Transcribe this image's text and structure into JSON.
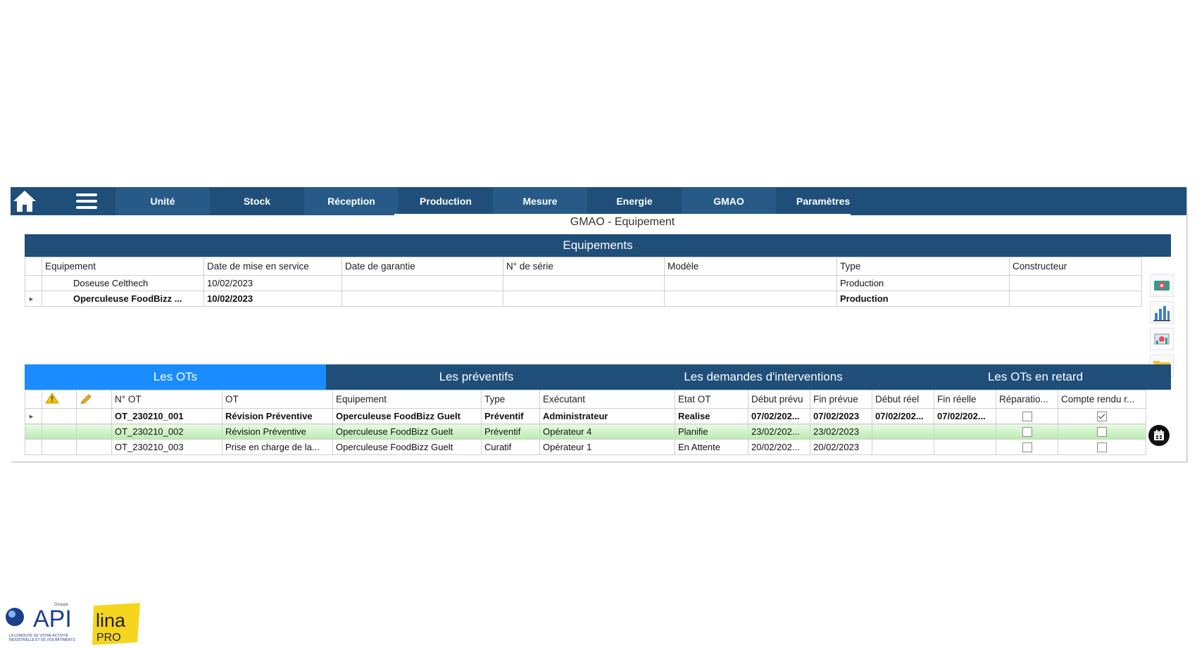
{
  "nav": {
    "tabs": [
      "Unité",
      "Stock",
      "Réception",
      "Production",
      "Mesure",
      "Energie",
      "GMAO",
      "Paramètres"
    ]
  },
  "page_title": "GMAO - Equipement",
  "equipements": {
    "title": "Equipements",
    "columns": [
      "Equipement",
      "Date de mise en service",
      "Date de garantie",
      "N° de série",
      "Modèle",
      "Type",
      "Constructeur"
    ],
    "rows": [
      {
        "equipement": "Doseuse Celthech",
        "date_service": "10/02/2023",
        "date_garantie": "",
        "serie": "",
        "modele": "",
        "type": "Production",
        "constructeur": ""
      },
      {
        "equipement": "Operculeuse FoodBizz ...",
        "date_service": "10/02/2023",
        "date_garantie": "",
        "serie": "",
        "modele": "",
        "type": "Production",
        "constructeur": ""
      }
    ]
  },
  "ot_tabs": [
    "Les OTs",
    "Les préventifs",
    "Les demandes d'interventions",
    "Les OTs en retard"
  ],
  "ots": {
    "columns": [
      "N° OT",
      "OT",
      "Equipement",
      "Type",
      "Exécutant",
      "Etat OT",
      "Début prévu",
      "Fin prévue",
      "Début réel",
      "Fin réelle",
      "Réparatio...",
      "Compte rendu r..."
    ],
    "rows": [
      {
        "num": "OT_230210_001",
        "ot": "Révision Préventive",
        "equipement": "Operculeuse FoodBizz Guelt",
        "type": "Préventif",
        "executant": "Administrateur",
        "etat": "Realise",
        "debut_prevu": "07/02/202...",
        "fin_prevue": "07/02/2023",
        "debut_reel": "07/02/202...",
        "fin_reelle": "07/02/202...",
        "reparation": false,
        "compte_rendu": true
      },
      {
        "num": "OT_230210_002",
        "ot": "Révision Préventive",
        "equipement": "Operculeuse FoodBizz Guelt",
        "type": "Préventif",
        "executant": "Opérateur 4",
        "etat": "Planifie",
        "debut_prevu": "23/02/202...",
        "fin_prevue": "23/02/2023",
        "debut_reel": "",
        "fin_reelle": "",
        "reparation": false,
        "compte_rendu": false
      },
      {
        "num": "OT_230210_003",
        "ot": "Prise en charge de la...",
        "equipement": "Operculeuse FoodBizz Guelt",
        "type": "Curatif",
        "executant": "Opérateur 1",
        "etat": "En Attente",
        "debut_prevu": "20/02/202...",
        "fin_prevue": "20/02/2023",
        "debut_reel": "",
        "fin_reelle": "",
        "reparation": false,
        "compte_rendu": false
      }
    ]
  },
  "side_icons": [
    "equipment-settings-icon",
    "bar-chart-icon",
    "equipment-chart-icon",
    "folder-icon"
  ],
  "logos": {
    "api_top": "Groupe",
    "api": "API",
    "api_tagline_1": "LA CONDUITE DE VOTRE ACTIVITÉ",
    "api_tagline_2": "INDUSTRIELLE ET DE VOS BÂTIMENTS",
    "lina": "lina",
    "pro": "PRO"
  },
  "colors": {
    "nav": "#1f4e79",
    "active_tab": "#1a8cff",
    "selected_row": "#c6f0bd"
  }
}
